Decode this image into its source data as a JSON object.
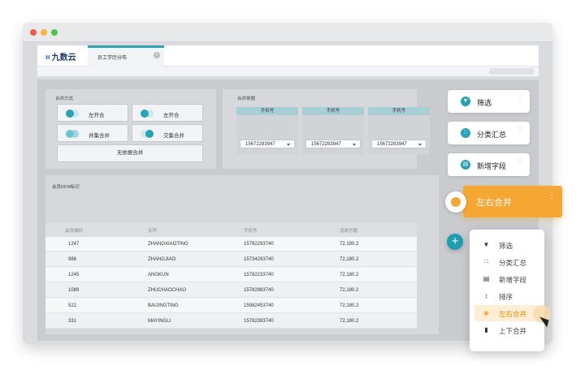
{
  "app": {
    "logo_mark": "⌗",
    "logo_text": "九数云",
    "tab_label": "员工学历分布",
    "tab_close": "×"
  },
  "merge_mode": {
    "title": "合并方式",
    "options": [
      {
        "label": "左开合"
      },
      {
        "label": "左开合"
      },
      {
        "label": "并集合并"
      },
      {
        "label": "交集合并"
      }
    ],
    "no_basis_label": "无依据合并"
  },
  "merge_basis": {
    "title": "合并依据",
    "columns": [
      {
        "header": "手机号",
        "value": "15672283947"
      },
      {
        "header": "手机号",
        "value": "15672283947"
      },
      {
        "header": "手机号",
        "value": "15672283947"
      }
    ]
  },
  "rfm": {
    "title": "会员RFM标识",
    "headers": [
      "会员编码",
      "名称",
      "手机号",
      "消费总额"
    ],
    "rows": [
      [
        "1247",
        "ZHANGXIAOTING",
        "15782293740",
        "72,180.2"
      ],
      [
        "986",
        "ZHANGJIAO",
        "15734293740",
        "72,180.2"
      ],
      [
        "1245",
        "ANGKUN",
        "15782233740",
        "72,180.2"
      ],
      [
        "1089",
        "ZHUCHAOCHAO",
        "15782983740",
        "72,180.2"
      ],
      [
        "522",
        "BAIJINGTING",
        "15982453740",
        "72,180.2"
      ],
      [
        "331",
        "MAYINGLI",
        "15782393740",
        "72,180.2"
      ]
    ]
  },
  "side_steps": [
    {
      "label": "筛选",
      "icon": "filter-icon",
      "glyph": "▼"
    },
    {
      "label": "分类汇总",
      "icon": "grid-icon",
      "glyph": "∷"
    },
    {
      "label": "新增字段",
      "icon": "field-icon",
      "glyph": "▤"
    }
  ],
  "active_step": {
    "label": "左右合并",
    "color": "#f5a733"
  },
  "more_glyph": "⋮",
  "add_glyph": "+",
  "menu": {
    "items": [
      {
        "label": "筛选",
        "icon": "filter-icon",
        "glyph": "▼"
      },
      {
        "label": "分类汇总",
        "icon": "grid-icon",
        "glyph": "∷"
      },
      {
        "label": "新增字段",
        "icon": "field-icon",
        "glyph": "▤"
      },
      {
        "label": "排序",
        "icon": "sort-icon",
        "glyph": "↕"
      },
      {
        "label": "左右合并",
        "icon": "merge-lr-icon",
        "glyph": "◉"
      },
      {
        "label": "上下合并",
        "icon": "merge-tb-icon",
        "glyph": "▮"
      }
    ],
    "active_index": 4
  },
  "colors": {
    "accent": "#1f9db1",
    "highlight": "#f5a733"
  }
}
